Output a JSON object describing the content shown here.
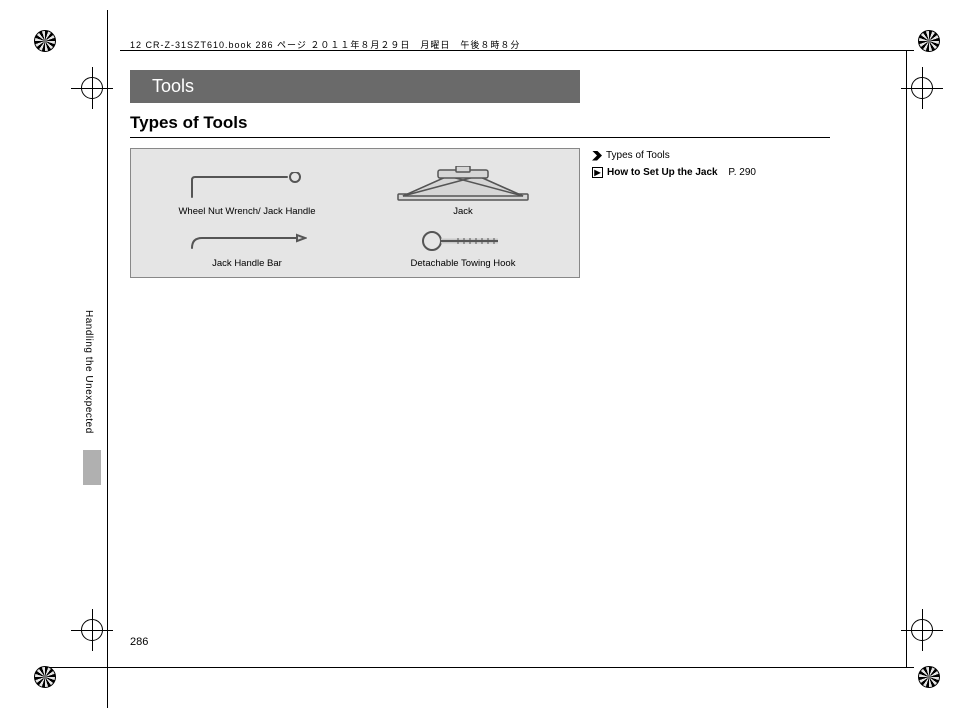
{
  "meta_header": "12 CR-Z-31SZT610.book  286 ページ  ２０１１年８月２９日　月曜日　午後８時８分",
  "chapter": "Tools",
  "section": "Types of Tools",
  "tools": {
    "wrench": "Wheel Nut Wrench/\nJack Handle",
    "jack": "Jack",
    "bar": "Jack Handle Bar",
    "hook": "Detachable Towing Hook"
  },
  "sidebar": {
    "heading": "Types of Tools",
    "link_label": "How to Set Up the Jack",
    "link_page": "P. 290"
  },
  "vertical_tab": "Handling the Unexpected",
  "page_number": "286"
}
